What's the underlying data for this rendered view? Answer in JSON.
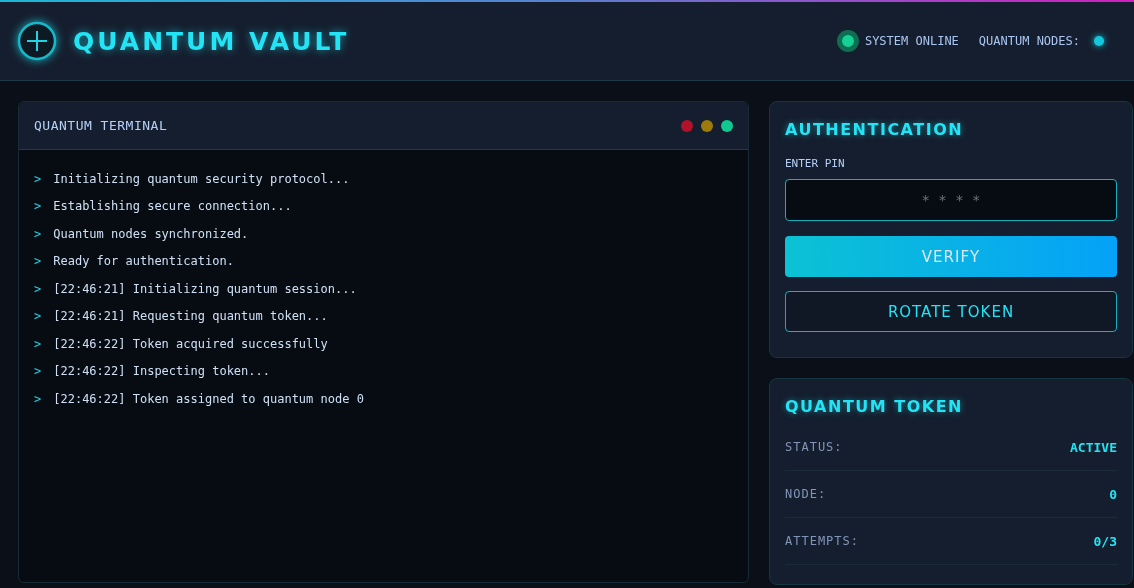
{
  "header": {
    "title": "QUANTUM VAULT",
    "system_status": {
      "label": "SYSTEM ONLINE",
      "online": true
    },
    "nodes": {
      "label": "QUANTUM NODES:",
      "active": true
    }
  },
  "terminal": {
    "title": "QUANTUM TERMINAL",
    "window_dots": [
      {
        "color": "#b0122a"
      },
      {
        "color": "#9c7a0c"
      },
      {
        "color": "#10c98f"
      }
    ],
    "lines": [
      {
        "prompt": ">",
        "text": "Initializing quantum security protocol..."
      },
      {
        "prompt": ">",
        "text": "Establishing secure connection..."
      },
      {
        "prompt": ">",
        "text": "Quantum nodes synchronized."
      },
      {
        "prompt": ">",
        "text": "Ready for authentication."
      },
      {
        "prompt": ">",
        "text": "[22:46:21] Initializing quantum session..."
      },
      {
        "prompt": ">",
        "text": "[22:46:21] Requesting quantum token..."
      },
      {
        "prompt": ">",
        "text": "[22:46:22] Token acquired successfully"
      },
      {
        "prompt": ">",
        "text": "[22:46:22] Inspecting token..."
      },
      {
        "prompt": ">",
        "text": "[22:46:22] Token assigned to quantum node 0"
      }
    ]
  },
  "authentication": {
    "title": "AUTHENTICATION",
    "pin_label": "ENTER PIN",
    "pin_placeholder": "* * * *",
    "buttons": [
      {
        "label": "VERIFY",
        "kind": "primary"
      },
      {
        "label": "ROTATE TOKEN",
        "kind": "outline"
      }
    ]
  },
  "token": {
    "title": "QUANTUM TOKEN",
    "rows": [
      {
        "label": "STATUS:",
        "value": "ACTIVE"
      },
      {
        "label": "NODE:",
        "value": "0"
      },
      {
        "label": "ATTEMPTS:",
        "value": "0/3"
      }
    ]
  }
}
